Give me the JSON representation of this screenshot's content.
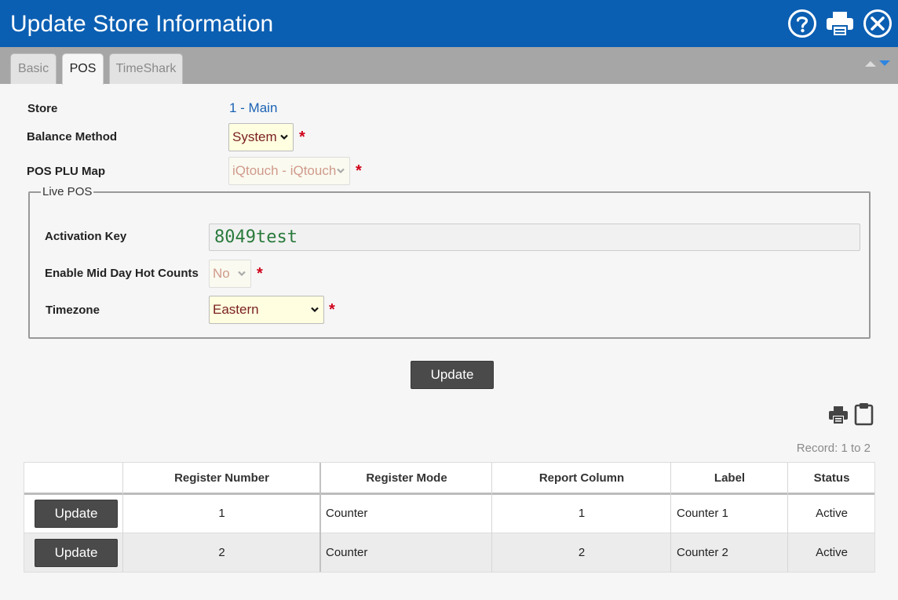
{
  "window": {
    "title": "Update Store Information",
    "icons": [
      "help-circle-icon",
      "print-icon",
      "close-circle-icon"
    ]
  },
  "tabs": [
    {
      "label": "Basic",
      "active": false
    },
    {
      "label": "POS",
      "active": true
    },
    {
      "label": "TimeShark",
      "active": false
    }
  ],
  "form": {
    "store_label": "Store",
    "store_value": "1 - Main",
    "balance_method_label": "Balance Method",
    "balance_method_value": "System",
    "pos_plu_map_label": "POS PLU Map",
    "pos_plu_map_value": "iQtouch - iQtouch",
    "required_mark": "*"
  },
  "live_pos": {
    "legend": "Live POS",
    "activation_key_label": "Activation Key",
    "activation_key_value": "8049test",
    "mid_day_label": "Enable Mid Day Hot Counts",
    "mid_day_value": "No",
    "timezone_label": "Timezone",
    "timezone_value": "Eastern"
  },
  "update_button": "Update",
  "toolbar_icons": [
    "print-icon",
    "clipboard-icon"
  ],
  "record_text": "Record: 1 to 2",
  "grid": {
    "columns": [
      "",
      "Register Number",
      "Register Mode",
      "Report Column",
      "Label",
      "Status"
    ],
    "rows": [
      {
        "action": "Update",
        "register_number": "1",
        "register_mode": "Counter",
        "report_column": "1",
        "label": "Counter 1",
        "status": "Active"
      },
      {
        "action": "Update",
        "register_number": "2",
        "register_mode": "Counter",
        "report_column": "2",
        "label": "Counter 2",
        "status": "Active"
      }
    ]
  },
  "colors": {
    "titlebar": "#0b5fb2",
    "tabbar": "#a6a6a6",
    "button": "#4a4a4a",
    "required": "#d0021b",
    "link_value": "#1a62b4",
    "select_bg": "#fffee0"
  }
}
